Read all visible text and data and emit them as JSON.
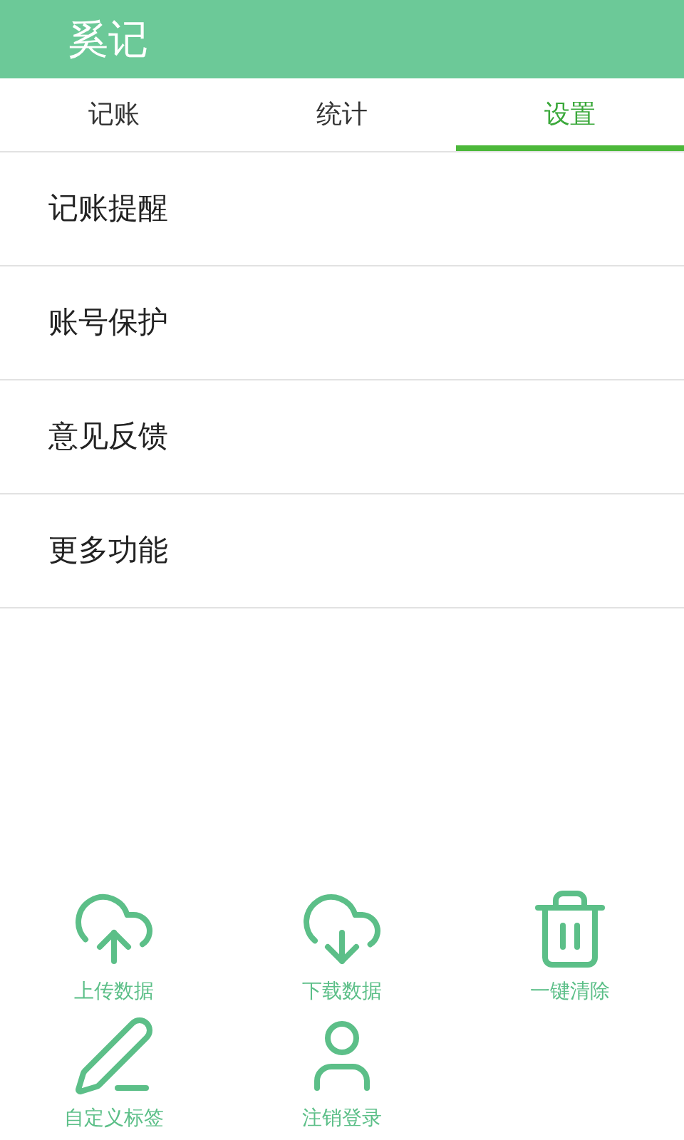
{
  "app_bar": {
    "title": "奚记"
  },
  "tabs": [
    {
      "label": "记账",
      "selected": false
    },
    {
      "label": "统计",
      "selected": false
    },
    {
      "label": "设置",
      "selected": true
    }
  ],
  "menu": [
    "记账提醒",
    "账号保护",
    "意见反馈",
    "更多功能"
  ],
  "actions": [
    {
      "kind": "upload",
      "label": "上传数据"
    },
    {
      "kind": "download",
      "label": "下载数据"
    },
    {
      "kind": "trash",
      "label": "一键清除"
    },
    {
      "kind": "pen",
      "label": "自定义标签"
    },
    {
      "kind": "user",
      "label": "注销登录"
    }
  ]
}
